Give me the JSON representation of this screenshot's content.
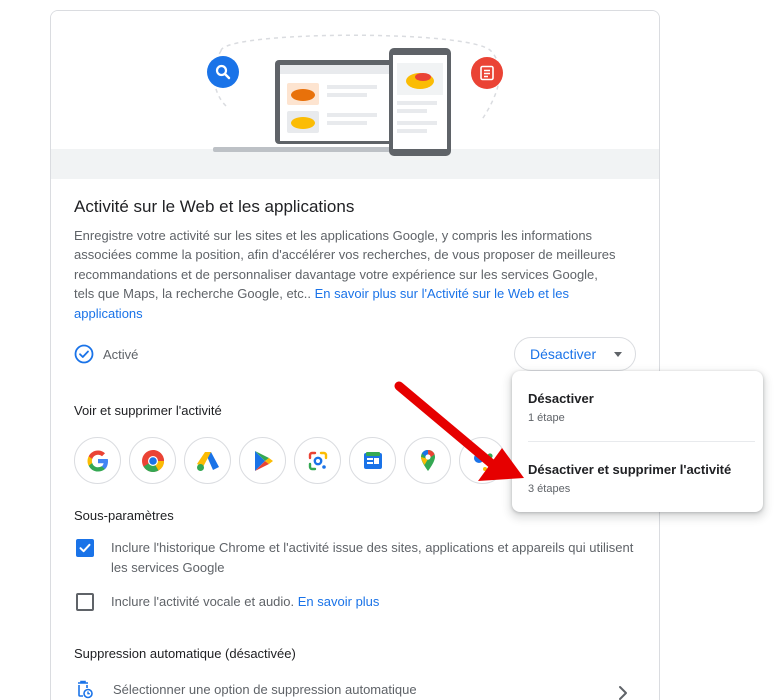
{
  "card": {
    "title": "Activité sur le Web et les applications",
    "description": "Enregistre votre activité sur les sites et les applications Google, y compris les informations associées comme la position, afin d'accélérer vos recherches, de vous proposer de meilleures recommandations et de personnaliser davantage votre expérience sur les services Google, tels que Maps, la recherche Google, etc..",
    "learn_more_link": "En savoir plus sur l'Activité sur le Web et les applications",
    "status_label": "Activé",
    "disable_button": "Désactiver"
  },
  "view_delete": {
    "heading": "Voir et supprimer l'activité",
    "apps": [
      "google-icon",
      "chrome-icon",
      "ads-icon",
      "play-icon",
      "lens-icon",
      "news-icon",
      "maps-icon",
      "assistant-icon"
    ]
  },
  "sub_settings": {
    "heading": "Sous-paramètres",
    "items": [
      {
        "label": "Inclure l'historique Chrome et l'activité issue des sites, applications et appareils qui utilisent les services Google",
        "checked": true
      },
      {
        "label": "Inclure l'activité vocale et audio.",
        "link": "En savoir plus",
        "checked": false
      }
    ]
  },
  "auto_delete": {
    "heading": "Suppression automatique (désactivée)",
    "option_label": "Sélectionner une option de suppression automatique"
  },
  "menu": {
    "items": [
      {
        "label": "Désactiver",
        "sub": "1 étape"
      },
      {
        "label": "Désactiver et supprimer l'activité",
        "sub": "3 étapes"
      }
    ]
  },
  "colors": {
    "accent": "#1a73e8",
    "annotation_arrow": "#e60000"
  }
}
